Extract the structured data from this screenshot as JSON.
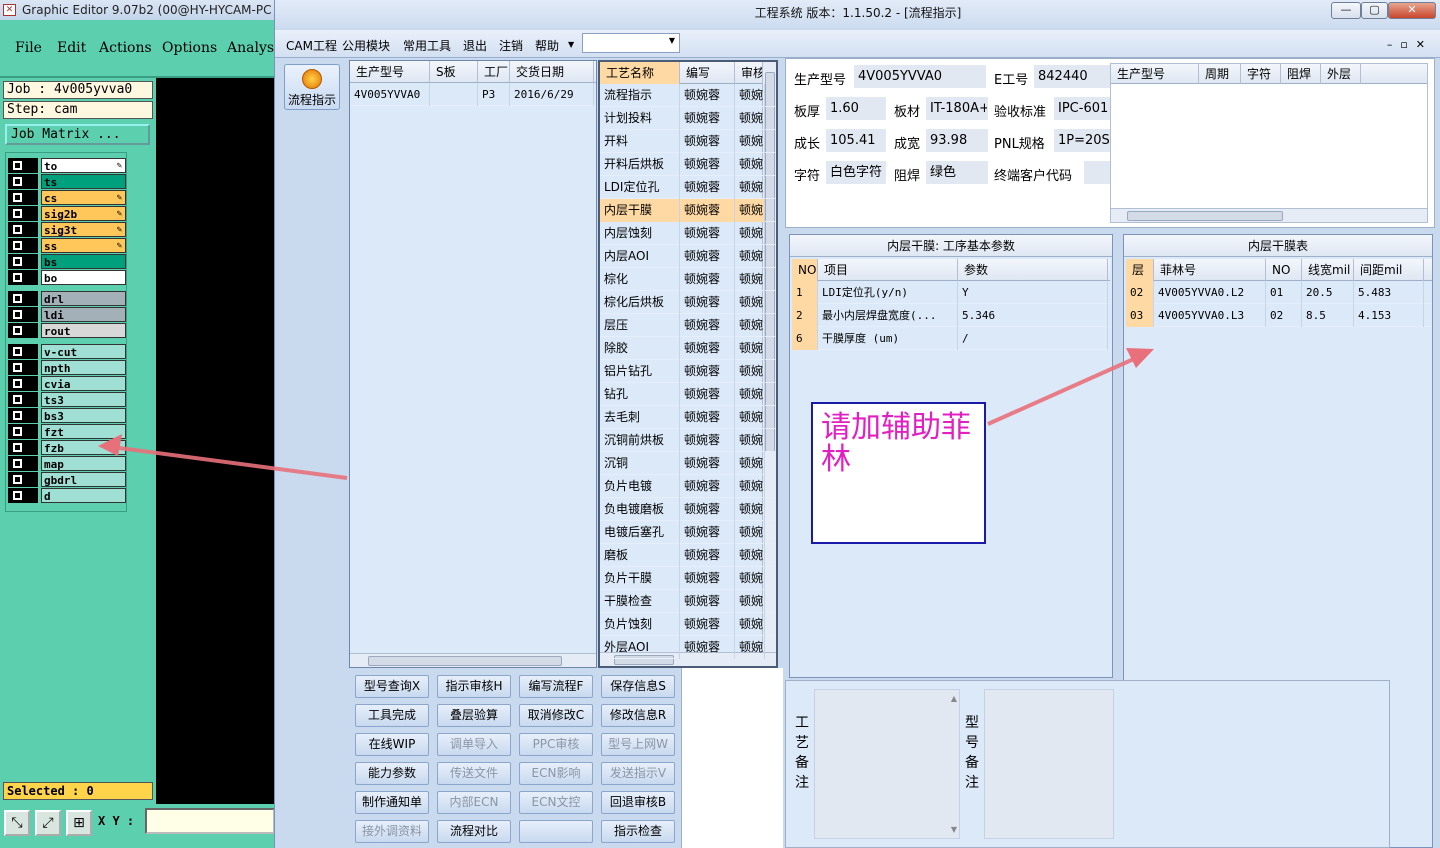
{
  "ge": {
    "title": "Graphic Editor 9.07b2 (00@HY-HYCAM-PC",
    "menu": [
      "File",
      "Edit",
      "Actions",
      "Options",
      "Analysi"
    ],
    "job": "Job : 4v005yvva0",
    "step": "Step: cam",
    "matrix": "Job Matrix ...",
    "layers": [
      {
        "name": "to",
        "color": "#ffffff",
        "edit": "✎"
      },
      {
        "name": "ts",
        "color": "#00a07c",
        "edit": ""
      },
      {
        "name": "cs",
        "color": "#ffc65a",
        "edit": "✎"
      },
      {
        "name": "sig2b",
        "color": "#ffc65a",
        "edit": "✎"
      },
      {
        "name": "sig3t",
        "color": "#ffc65a",
        "edit": "✎"
      },
      {
        "name": "ss",
        "color": "#ffc65a",
        "edit": "✎"
      },
      {
        "name": "bs",
        "color": "#00a07c",
        "edit": ""
      },
      {
        "name": "bo",
        "color": "#ffffff",
        "edit": ""
      },
      {
        "name": "drl",
        "color": "#a4b0b8",
        "edit": ""
      },
      {
        "name": "ldi",
        "color": "#a4b0b8",
        "edit": ""
      },
      {
        "name": "rout",
        "color": "#d8d8d8",
        "edit": ""
      },
      {
        "name": "v-cut",
        "color": "#9fdfd4",
        "edit": ""
      },
      {
        "name": "npth",
        "color": "#9fdfd4",
        "edit": ""
      },
      {
        "name": "cvia",
        "color": "#9fdfd4",
        "edit": ""
      },
      {
        "name": "ts3",
        "color": "#9fdfd4",
        "edit": ""
      },
      {
        "name": "bs3",
        "color": "#9fdfd4",
        "edit": ""
      },
      {
        "name": "fzt",
        "color": "#9fdfd4",
        "edit": ""
      },
      {
        "name": "fzb",
        "color": "#9fdfd4",
        "edit": ""
      },
      {
        "name": "map",
        "color": "#9fdfd4",
        "edit": ""
      },
      {
        "name": "gbdrl",
        "color": "#9fdfd4",
        "edit": ""
      },
      {
        "name": "d",
        "color": "#9fdfd4",
        "edit": ""
      }
    ],
    "selected": "Selected : 0",
    "xy_label": "X Y :"
  },
  "mw": {
    "title": "工程系统   版本：1.1.50.2 - [流程指示]",
    "menu": [
      "CAM工程",
      "公用模块",
      "常用工具",
      "退出",
      "注销",
      "帮助"
    ],
    "flow_button": "流程指示",
    "orders": {
      "headers": [
        "生产型号",
        "S板",
        "工厂",
        "交货日期"
      ],
      "rows": [
        [
          "4V005YVVA0",
          "",
          "P3",
          "2016/6/29"
        ]
      ]
    },
    "process": {
      "headers": [
        "工艺名称",
        "编写",
        "审核"
      ],
      "rows": [
        [
          "流程指示",
          "顿婉蓉",
          "顿婉"
        ],
        [
          "计划投料",
          "顿婉蓉",
          "顿婉"
        ],
        [
          "开料",
          "顿婉蓉",
          "顿婉"
        ],
        [
          "开料后烘板",
          "顿婉蓉",
          "顿婉"
        ],
        [
          "LDI定位孔",
          "顿婉蓉",
          "顿婉"
        ],
        [
          "内层干膜",
          "顿婉蓉",
          "顿婉"
        ],
        [
          "内层蚀刻",
          "顿婉蓉",
          "顿婉"
        ],
        [
          "内层AOI",
          "顿婉蓉",
          "顿婉"
        ],
        [
          "棕化",
          "顿婉蓉",
          "顿婉"
        ],
        [
          "棕化后烘板",
          "顿婉蓉",
          "顿婉"
        ],
        [
          "层压",
          "顿婉蓉",
          "顿婉"
        ],
        [
          "除胶",
          "顿婉蓉",
          "顿婉"
        ],
        [
          "铝片钻孔",
          "顿婉蓉",
          "顿婉"
        ],
        [
          "钻孔",
          "顿婉蓉",
          "顿婉"
        ],
        [
          "去毛刺",
          "顿婉蓉",
          "顿婉"
        ],
        [
          "沉铜前烘板",
          "顿婉蓉",
          "顿婉"
        ],
        [
          "沉铜",
          "顿婉蓉",
          "顿婉"
        ],
        [
          "负片电镀",
          "顿婉蓉",
          "顿婉"
        ],
        [
          "负电镀磨板",
          "顿婉蓉",
          "顿婉"
        ],
        [
          "电镀后塞孔",
          "顿婉蓉",
          "顿婉"
        ],
        [
          "磨板",
          "顿婉蓉",
          "顿婉"
        ],
        [
          "负片干膜",
          "顿婉蓉",
          "顿婉"
        ],
        [
          "干膜检查",
          "顿婉蓉",
          "顿婉"
        ],
        [
          "负片蚀刻",
          "顿婉蓉",
          "顿婉"
        ],
        [
          "外层AOI",
          "顿婉蓉",
          "顿婉"
        ]
      ],
      "selected_index": 5
    },
    "buttons": [
      {
        "label": "型号查询X",
        "disabled": false
      },
      {
        "label": "指示审核H",
        "disabled": false
      },
      {
        "label": "编写流程F",
        "disabled": false
      },
      {
        "label": "保存信息S",
        "disabled": false
      },
      {
        "label": "工具完成",
        "disabled": false
      },
      {
        "label": "叠层验算",
        "disabled": false
      },
      {
        "label": "取消修改C",
        "disabled": false
      },
      {
        "label": "修改信息R",
        "disabled": false
      },
      {
        "label": "在线WIP",
        "disabled": false
      },
      {
        "label": "调单导入",
        "disabled": true
      },
      {
        "label": "PPC审核",
        "disabled": true
      },
      {
        "label": "型号上网W",
        "disabled": true
      },
      {
        "label": "能力参数",
        "disabled": false
      },
      {
        "label": "传送文件",
        "disabled": true
      },
      {
        "label": "ECN影响",
        "disabled": true
      },
      {
        "label": "发送指示V",
        "disabled": true
      },
      {
        "label": "制作通知单",
        "disabled": false
      },
      {
        "label": "内部ECN",
        "disabled": true
      },
      {
        "label": "ECN文控",
        "disabled": true
      },
      {
        "label": "回退审核B",
        "disabled": false
      },
      {
        "label": "接外调资料",
        "disabled": true
      },
      {
        "label": "流程对比",
        "disabled": false
      },
      {
        "label": "",
        "disabled": false
      },
      {
        "label": "指示检查",
        "disabled": false
      }
    ],
    "info": {
      "model_label": "生产型号",
      "model": "4V005YVVA0",
      "e_label": "E工号",
      "e_no": "842440",
      "thick_label": "板厚",
      "thick": "1.60",
      "mat_label": "板材",
      "mat": "IT-180A+",
      "std_label": "验收标准",
      "std": "IPC-601",
      "len_label": "成长",
      "len": "105.41",
      "wid_label": "成宽",
      "wid": "93.98",
      "pnl_label": "PNL规格",
      "pnl": "1P=20S",
      "char_label": "字符",
      "char": "白色字符",
      "mask_label": "阻焊",
      "mask": "绿色",
      "cust_label": "终端客户代码",
      "cust": ""
    },
    "mini_grid": {
      "headers": [
        "生产型号",
        "周期",
        "字符",
        "阻焊",
        "外层"
      ]
    },
    "params": {
      "title": "内层干膜: 工序基本参数",
      "headers": [
        "NO",
        "项目",
        "参数"
      ],
      "rows": [
        [
          "1",
          "LDI定位孔(y/n)",
          "Y"
        ],
        [
          "2",
          "最小内层焊盘宽度(...",
          "5.346"
        ],
        [
          "6",
          "干膜厚度 (um)",
          "/"
        ]
      ]
    },
    "film": {
      "title": "内层干膜表",
      "headers": [
        "层",
        "菲林号",
        "NO",
        "线宽mil",
        "间距mil"
      ],
      "rows": [
        [
          "02",
          "4V005YVVA0.L2",
          "01",
          "20.5",
          "5.483"
        ],
        [
          "03",
          "4V005YVVA0.L3",
          "02",
          "8.5",
          "4.153"
        ]
      ]
    },
    "note": "请加辅助菲林",
    "remark_labels": [
      "工艺备注",
      "型号备注"
    ]
  },
  "colors": {
    "arrow": "#e8707a",
    "note_text": "#e020c0",
    "note_border": "#1a1aa8",
    "selected_row": "#ffd9a3"
  }
}
